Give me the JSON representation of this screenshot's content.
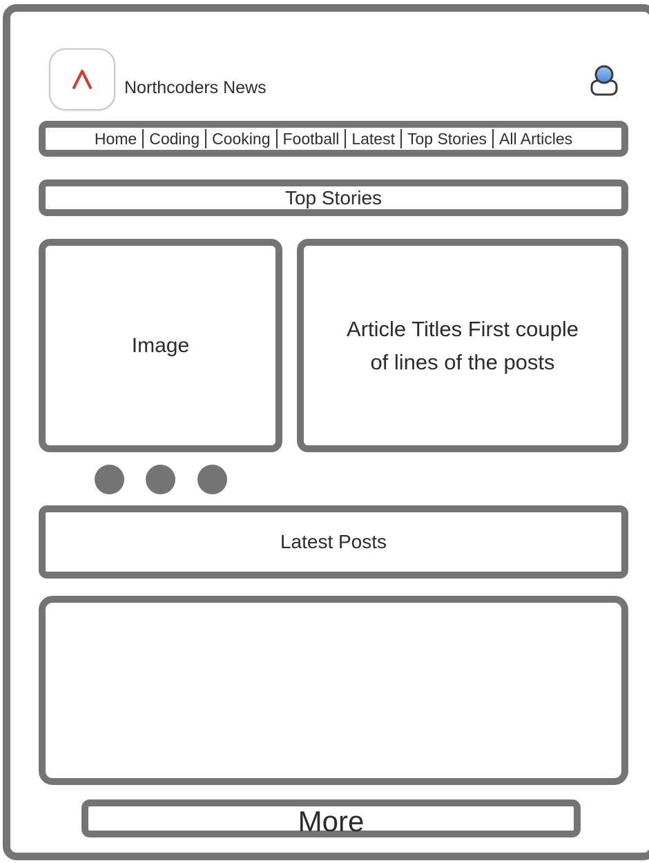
{
  "header": {
    "site_title": "Northcoders News",
    "logo_icon": "caret-up-icon",
    "logo_color": "#d63a2f",
    "user_icon": "user-avatar-icon"
  },
  "nav": {
    "items": [
      {
        "label": "Home"
      },
      {
        "label": "Coding"
      },
      {
        "label": "Cooking"
      },
      {
        "label": "Football"
      },
      {
        "label": "Latest"
      },
      {
        "label": "Top Stories"
      },
      {
        "label": "All Articles"
      }
    ]
  },
  "top_stories": {
    "heading": "Top Stories",
    "image_label": "Image",
    "article_text": "Article Titles First couple of lines of the posts",
    "carousel_dots": 3
  },
  "latest_posts": {
    "heading": "Latest Posts"
  },
  "more_button": {
    "label": "More"
  },
  "colors": {
    "border": "#747474",
    "text": "#2e2e2e"
  }
}
